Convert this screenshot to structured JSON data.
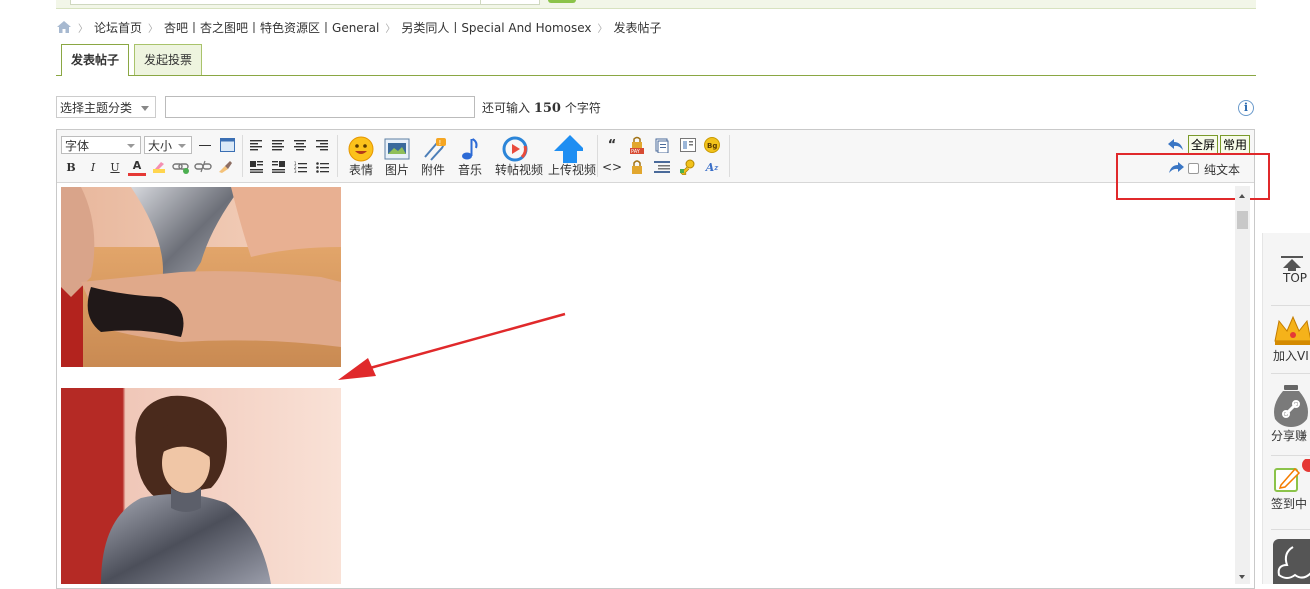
{
  "breadcrumb": {
    "items": [
      "论坛首页",
      "杏吧丨杏之图吧丨特色资源区丨General",
      "另类同人丨Special And Homosex",
      "发表帖子"
    ]
  },
  "tabs": [
    {
      "label": "发表帖子",
      "active": true
    },
    {
      "label": "发起投票",
      "active": false
    }
  ],
  "subject": {
    "category_select": "选择主题分类",
    "title_value": "",
    "remaining_prefix": "还可输入",
    "remaining_count": "150",
    "remaining_suffix": "个字符"
  },
  "toolbar": {
    "font_select": "字体",
    "size_select": "大小",
    "bold": "B",
    "italic": "I",
    "underline": "U",
    "color": "A",
    "insert_buttons": [
      "表情",
      "图片",
      "附件",
      "音乐",
      "转帖视频",
      "上传视频"
    ],
    "fullscreen": "全屏",
    "common": "常用",
    "plain_text": "纯文本"
  },
  "side_panel": {
    "items": [
      "TOP",
      "加入VI",
      "分享赚",
      "签到中"
    ]
  },
  "colors": {
    "accent_green": "#8aa743",
    "highlight_red": "#e0292b",
    "tab_bg": "#eef4df"
  }
}
